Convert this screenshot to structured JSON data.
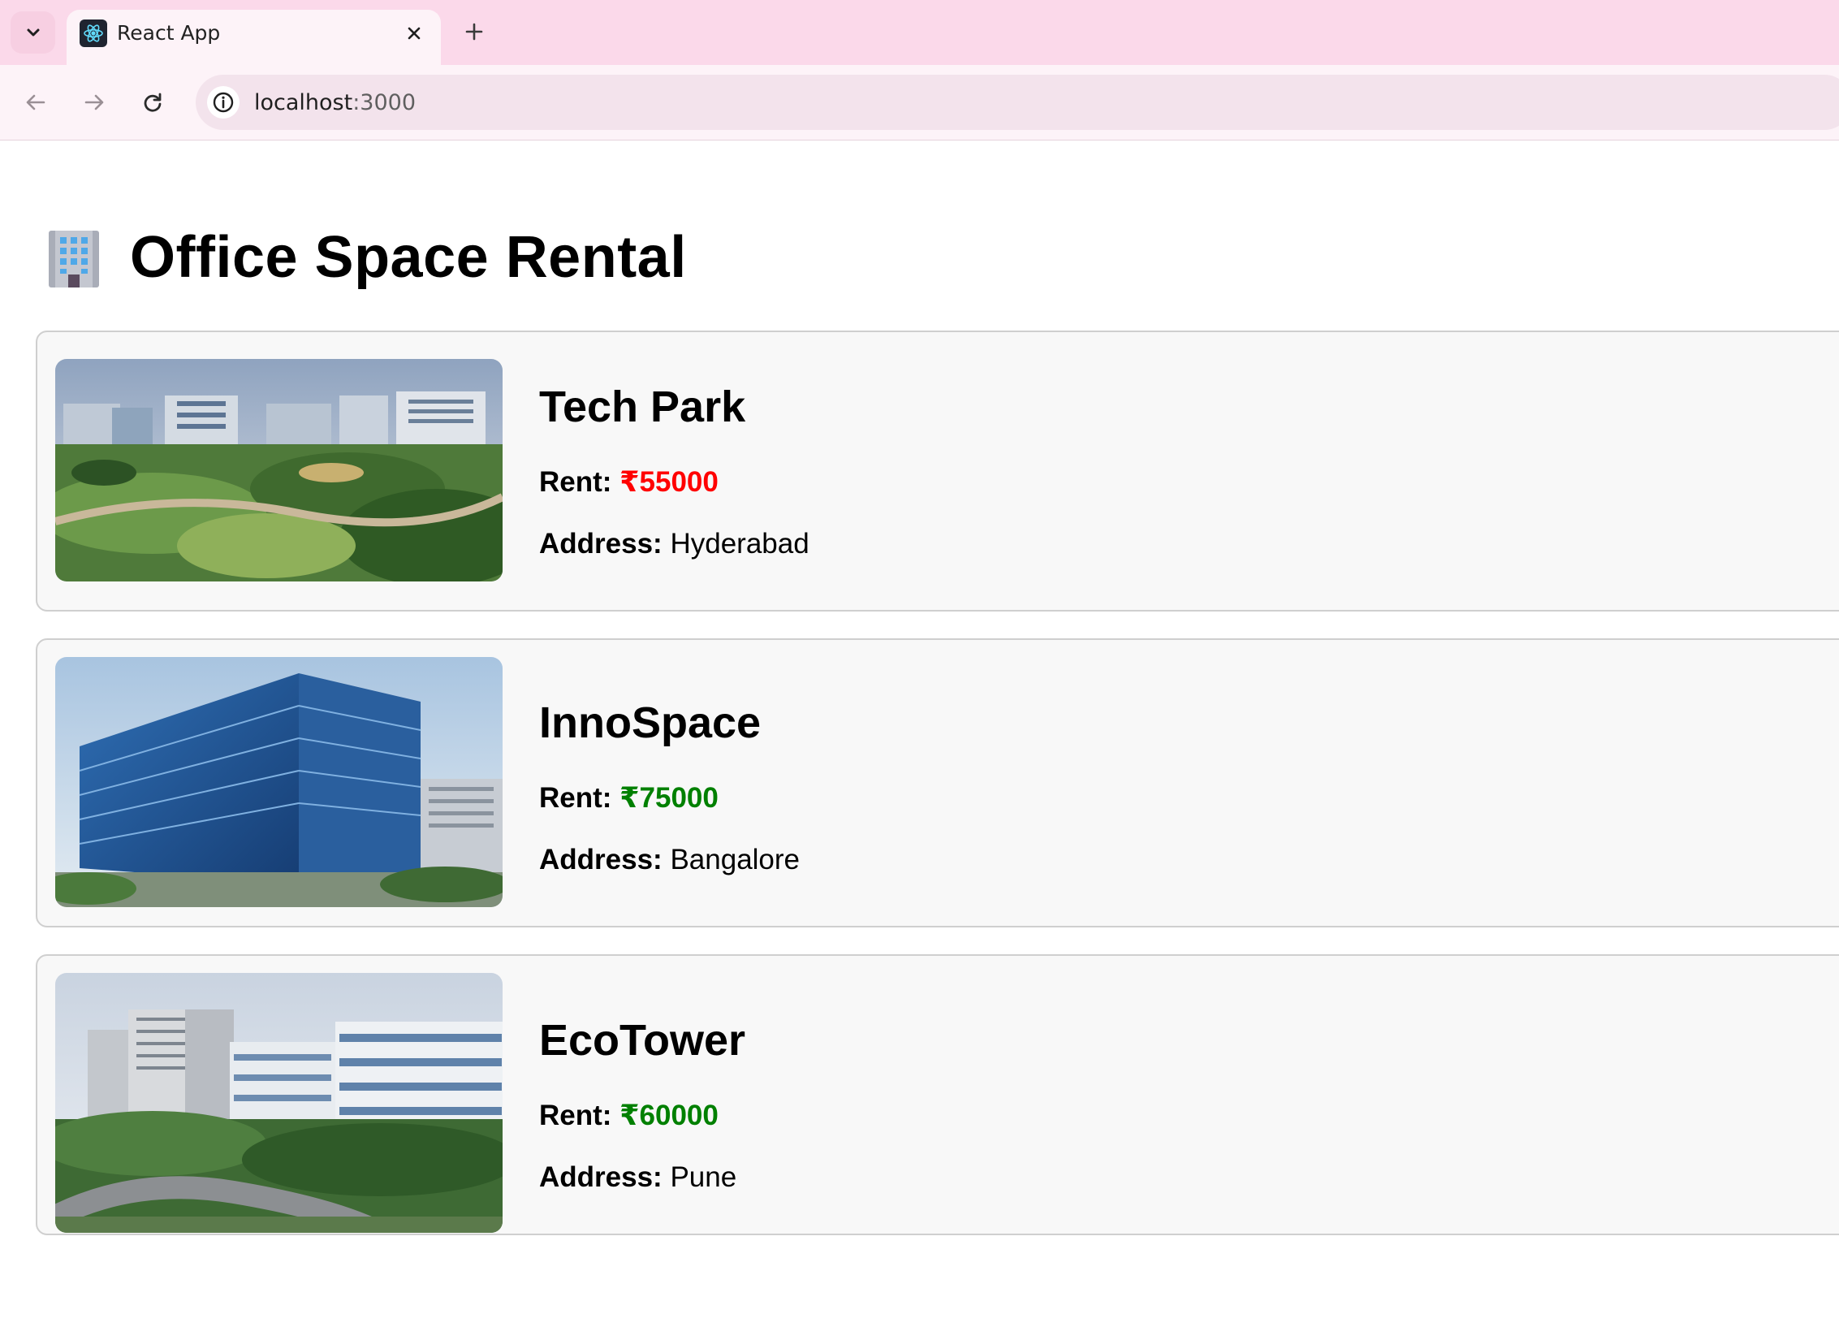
{
  "browser": {
    "tab_title": "React App",
    "url_host": "localhost",
    "url_port": ":3000"
  },
  "page": {
    "title": "Office Space Rental",
    "rent_label": "Rent:",
    "address_label": "Address:"
  },
  "offices": [
    {
      "name": "Tech Park",
      "rent": "₹55000",
      "rent_color": "#ff0000",
      "address": "Hyderabad"
    },
    {
      "name": "InnoSpace",
      "rent": "₹75000",
      "rent_color": "#008000",
      "address": "Bangalore"
    },
    {
      "name": "EcoTower",
      "rent": "₹60000",
      "rent_color": "#008000",
      "address": "Pune"
    }
  ],
  "colors": {
    "chrome_tab_strip": "#fbd9ea",
    "chrome_toolbar": "#fdf3f8",
    "card_background": "#f8f8f8",
    "rent_red": "#ff0000",
    "rent_green": "#008000"
  }
}
